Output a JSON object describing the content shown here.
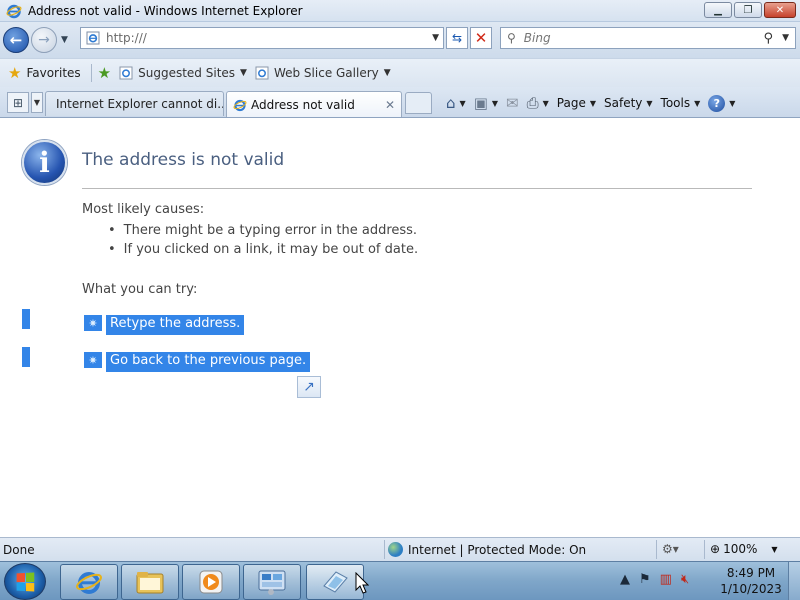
{
  "window": {
    "title": "Address not valid - Windows Internet Explorer",
    "min_symbol": "▁",
    "max_symbol": "❐",
    "close_symbol": "✕"
  },
  "address_bar": {
    "url": "http:///",
    "back_symbol": "←",
    "forward_symbol": "→",
    "refresh_symbol": "⇆",
    "stop_symbol": "✕"
  },
  "search": {
    "placeholder": "Bing",
    "go_symbol": "⚲"
  },
  "favorites_bar": {
    "favorites_label": "Favorites",
    "links": [
      {
        "label": "Suggested Sites"
      },
      {
        "label": "Web Slice Gallery"
      }
    ]
  },
  "tabs": [
    {
      "label": "Internet Explorer cannot di...",
      "active": false
    },
    {
      "label": "Address not valid",
      "active": true
    }
  ],
  "command_bar": {
    "page_label": "Page",
    "safety_label": "Safety",
    "tools_label": "Tools",
    "help_symbol": "?"
  },
  "error_page": {
    "title": "The address is not valid",
    "causes_heading": "Most likely causes:",
    "causes": [
      "There might be a typing error in the address.",
      "If you clicked on a link, it may be out of date."
    ],
    "try_heading": "What you can try:",
    "actions": [
      "Retype the address.",
      "Go back to the previous page."
    ]
  },
  "status_bar": {
    "status": "Done",
    "zone": "Internet | Protected Mode: On",
    "zoom": "100%"
  },
  "taskbar": {
    "items": [
      {
        "name": "internet-explorer"
      },
      {
        "name": "windows-explorer"
      },
      {
        "name": "windows-media-player"
      },
      {
        "name": "control-panel"
      },
      {
        "name": "paint",
        "active": true
      }
    ],
    "time": "8:49 PM",
    "date": "1/10/2023"
  },
  "colors": {
    "selection": "#3385e8",
    "title_text": "#4a5f80",
    "accent_blue": "#1a4fa8"
  }
}
